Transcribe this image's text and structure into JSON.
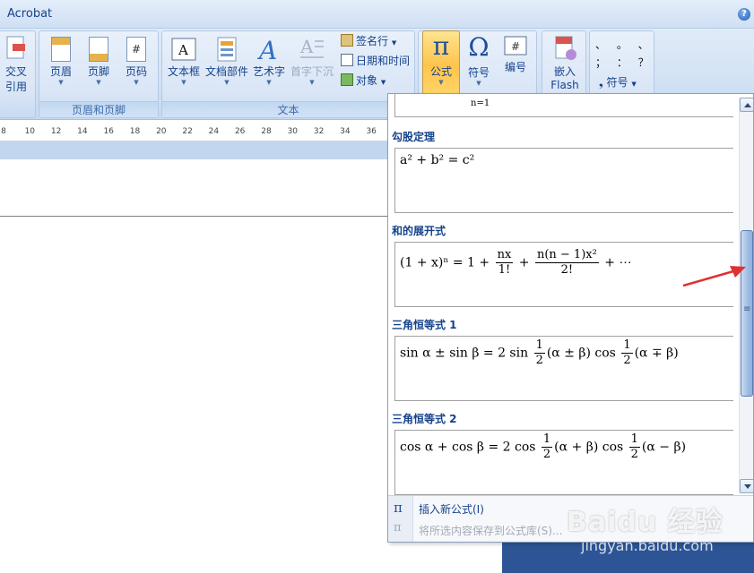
{
  "app": {
    "title": "Acrobat",
    "help_icon": "help-icon"
  },
  "ribbon": {
    "left_partial": {
      "button_label_1": "交叉",
      "button_label_2": "引用"
    },
    "header_footer_group": {
      "label": "页眉和页脚",
      "buttons": [
        {
          "label": "页眉",
          "icon": "header-icon"
        },
        {
          "label": "页脚",
          "icon": "footer-icon"
        },
        {
          "label": "页码",
          "icon": "page-number-icon"
        }
      ]
    },
    "text_group": {
      "label": "文本",
      "buttons": [
        {
          "label": "文本框",
          "icon": "textbox-icon"
        },
        {
          "label": "文档部件",
          "icon": "quick-parts-icon"
        },
        {
          "label": "艺术字",
          "icon": "wordart-icon"
        },
        {
          "label": "首字下沉",
          "icon": "dropcap-icon",
          "disabled": true
        }
      ],
      "small_buttons": [
        {
          "label": "签名行",
          "icon": "signature-line-icon"
        },
        {
          "label": "日期和时间",
          "icon": "date-time-icon"
        },
        {
          "label": "对象",
          "icon": "object-icon"
        }
      ]
    },
    "symbols_group": {
      "buttons": [
        {
          "label": "公式",
          "icon": "pi-icon",
          "active": true
        },
        {
          "label": "符号",
          "icon": "omega-icon"
        },
        {
          "label": "编号",
          "icon": "number-icon"
        }
      ]
    },
    "flash_group": {
      "label_1": "嵌入",
      "label_2": "Flash"
    },
    "special_symbols": {
      "glyphs_row1": "、 。 、",
      "glyphs_row2": "； ： ？",
      "label": "符号"
    }
  },
  "ruler": {
    "ticks": [
      "8",
      "10",
      "12",
      "14",
      "16",
      "18",
      "20",
      "22",
      "24",
      "26",
      "28",
      "30",
      "32",
      "34",
      "36"
    ]
  },
  "gallery": {
    "top_cutoff": "n=1",
    "items": [
      {
        "category": "勾股定理",
        "equation": "a² + b² = c²"
      },
      {
        "category": "和的展开式",
        "equation_lhs": "(1 + x)ⁿ = 1 + ",
        "frac1_num": "nx",
        "frac1_den": "1!",
        "plus": " + ",
        "frac2_num": "n(n − 1)x²",
        "frac2_den": "2!",
        "tail": " + ⋯"
      },
      {
        "category": "三角恒等式 1",
        "lhs": "sin α ± sin β = 2 sin ",
        "frac_num": "1",
        "frac_den": "2",
        "mid": "(α ± β) cos ",
        "frac2_num": "1",
        "frac2_den": "2",
        "tail": "(α ∓ β)"
      },
      {
        "category": "三角恒等式 2",
        "lhs": "cos α + cos β = 2 cos ",
        "frac_num": "1",
        "frac_den": "2",
        "mid": "(α + β) cos ",
        "frac2_num": "1",
        "frac2_den": "2",
        "tail": "(α − β)"
      }
    ],
    "footer": {
      "insert_new": "插入新公式(I)",
      "save_selection": "将所选内容保存到公式库(S)..."
    }
  },
  "watermark": {
    "brand": "Baidu 经验",
    "url": "jingyan.baidu.com"
  }
}
